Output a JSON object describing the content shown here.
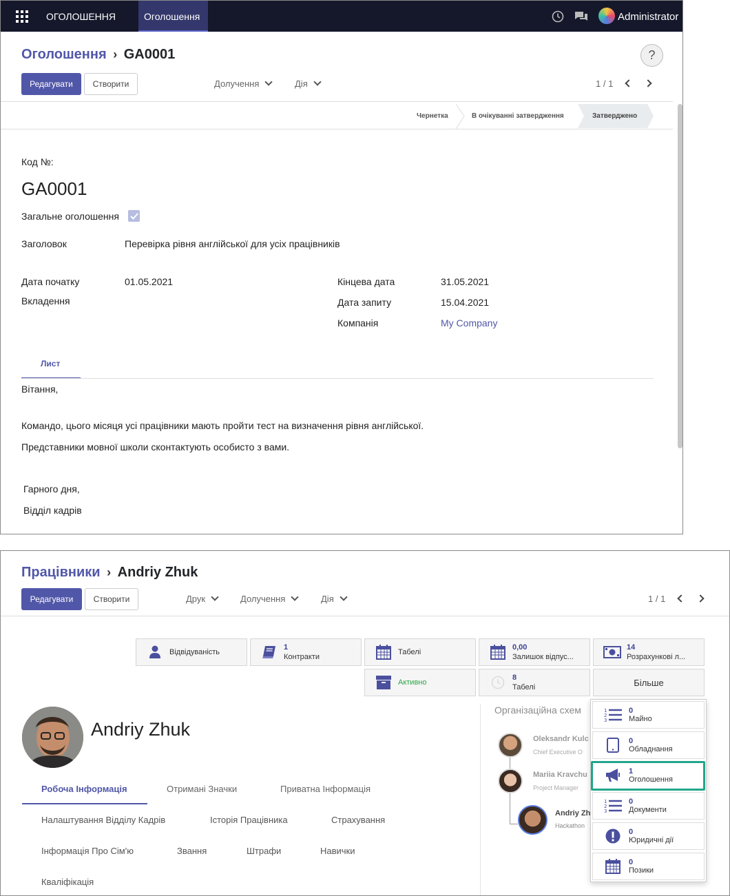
{
  "top": {
    "nav": {
      "app_title": "ОГОЛОШЕННЯ",
      "active_menu": "Оголошення",
      "user": "Administrator"
    },
    "breadcrumb": {
      "parent": "Оголошення",
      "current": "GA0001"
    },
    "help": "?",
    "buttons": {
      "edit": "Редагувати",
      "create": "Створити",
      "receive": "Долучення",
      "action": "Дія"
    },
    "pager": "1 / 1",
    "stages": [
      "Чернетка",
      "В очікуванні затвердження",
      "Затверджено"
    ],
    "form": {
      "code_label": "Код №:",
      "code": "GA0001",
      "general_label": "Загальне оголошення",
      "subject_label": "Заголовок",
      "subject": "Перевірка рівня англійської для усіх працівників",
      "start_label": "Дата початку",
      "start": "01.05.2021",
      "attach_label": "Вкладення",
      "end_label": "Кінцева дата",
      "end": "31.05.2021",
      "req_label": "Дата запиту",
      "req": "15.04.2021",
      "company_label": "Компанія",
      "company": "My Company"
    },
    "tab": "Лист",
    "letter": [
      "Вітання,",
      "Командо, цього місяця усі працівники мають пройти тест на визначення рівня англійської.",
      "Представники мовної школи сконтактують особисто з вами.",
      "Гарного дня,",
      "Відділ кадрів"
    ]
  },
  "bottom": {
    "breadcrumb": {
      "parent": "Працівники",
      "current": "Andriy Zhuk"
    },
    "buttons": {
      "edit": "Редагувати",
      "create": "Створити",
      "print": "Друк",
      "receive": "Долучення",
      "action": "Дія"
    },
    "pager": "1 / 1",
    "smart": {
      "attendance": "Відвідуваність",
      "contracts_num": "1",
      "contracts": "Контракти",
      "timesheets": "Табелі",
      "leave_num": "0,00",
      "leave": "Залишок відпус...",
      "payslips_num": "14",
      "payslips": "Розрахункові л...",
      "active": "Активно",
      "ts_num": "8",
      "ts": "Табелі",
      "more": "Більше"
    },
    "dropdown": [
      {
        "num": "0",
        "label": "Майно",
        "icon": "list-numbered-icon"
      },
      {
        "num": "0",
        "label": "Обладнання",
        "icon": "tablet-icon"
      },
      {
        "num": "1",
        "label": "Оголошення",
        "icon": "megaphone-icon"
      },
      {
        "num": "0",
        "label": "Документи",
        "icon": "list-numbered-icon"
      },
      {
        "num": "0",
        "label": "Юридичні дії",
        "icon": "alert-icon"
      },
      {
        "num": "0",
        "label": "Позики",
        "icon": "calendar-icon"
      }
    ],
    "employee_name": "Andriy Zhuk",
    "tabs": [
      "Робоча Інформація",
      "Отримані Значки",
      "Приватна Інформація"
    ],
    "sublinks": [
      "Налаштування Відділу Кадрів",
      "Історія Працівника",
      "Страхування",
      "Інформація Про Сім'ю",
      "Звання",
      "Штрафи",
      "Навички",
      "Кваліфікація"
    ],
    "org": {
      "title": "Організаційна схем",
      "people": [
        {
          "name": "Oleksandr Kulc",
          "role": "Chief Executive O"
        },
        {
          "name": "Mariia Kravchu",
          "role": "Project Manager"
        },
        {
          "name": "Andriy Zh",
          "role": "Hackathon"
        }
      ]
    },
    "colors": {
      "accent": "#5157a8",
      "highlight": "#21a58a",
      "active_green": "#28a745"
    }
  }
}
